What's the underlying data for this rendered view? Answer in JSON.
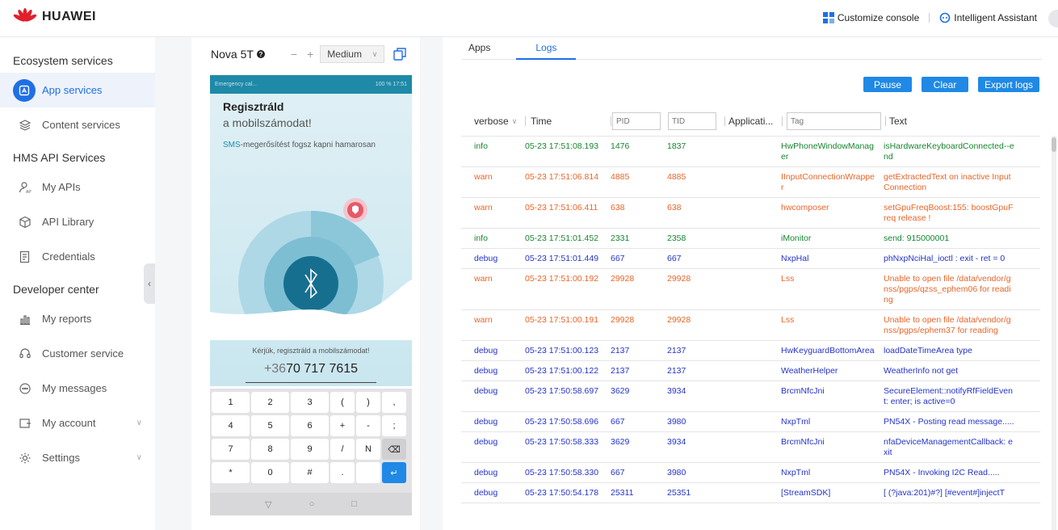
{
  "header": {
    "brand": "HUAWEI",
    "customize_console": "Customize console",
    "intelligent_assistant": "Intelligent Assistant"
  },
  "sidebar": {
    "sections": [
      {
        "title": "Ecosystem services"
      },
      {
        "title": "HMS API Services"
      },
      {
        "title": "Developer center"
      }
    ],
    "items": [
      {
        "label": "App services",
        "icon": "app-services-icon",
        "active": true
      },
      {
        "label": "Content services",
        "icon": "layers-icon"
      },
      {
        "label": "My APIs",
        "icon": "api-user-icon"
      },
      {
        "label": "API Library",
        "icon": "cube-icon"
      },
      {
        "label": "Credentials",
        "icon": "credentials-icon"
      },
      {
        "label": "My reports",
        "icon": "bar-chart-icon"
      },
      {
        "label": "Customer service",
        "icon": "headset-icon"
      },
      {
        "label": "My messages",
        "icon": "message-icon"
      },
      {
        "label": "My account",
        "icon": "account-icon"
      },
      {
        "label": "Settings",
        "icon": "gear-icon"
      }
    ]
  },
  "device": {
    "name": "Nova 5T",
    "size_selected": "Medium",
    "zoom_out": "−",
    "zoom_in": "+",
    "status_left": "Emergency cal...",
    "status_right": "100 %  17:51",
    "screen_title": "Regisztráld",
    "screen_subtitle": "a mobilszámodat!",
    "sms_highlight": "SMS",
    "sms_rest": "-megerősítést fogsz kapni hamarosan",
    "hint": "Kérjük, regisztráld a mobilszámodat!",
    "phone_prefix": "+36",
    "phone_number": "70 717 7615",
    "keys": [
      [
        "1",
        "2",
        "3",
        "(",
        ")",
        ","
      ],
      [
        "4",
        "5",
        "6",
        "+",
        "-",
        ";"
      ],
      [
        "7",
        "8",
        "9",
        "/",
        "N",
        "⌫"
      ],
      [
        "*",
        "0",
        "#",
        ".",
        "",
        "↵"
      ]
    ],
    "nav_back": "▽",
    "nav_home": "○",
    "nav_recent": "□"
  },
  "logs": {
    "tabs": [
      "Apps",
      "Logs"
    ],
    "active_tab": "Logs",
    "buttons": {
      "pause": "Pause",
      "clear": "Clear",
      "export": "Export logs"
    },
    "columns": {
      "level_filter": "verbose",
      "time": "Time",
      "pid_placeholder": "PID",
      "tid_placeholder": "TID",
      "application": "Applicati...",
      "tag_placeholder": "Tag",
      "text": "Text"
    },
    "rows": [
      {
        "level": "info",
        "time": "05-23 17:51:08.193",
        "pid": "1476",
        "tid": "1837",
        "tag": "HwPhoneWindowManager",
        "text": "isHardwareKeyboardConnected--end"
      },
      {
        "level": "warn",
        "time": "05-23 17:51:06.814",
        "pid": "4885",
        "tid": "4885",
        "tag": "IInputConnectionWrapper",
        "text": "getExtractedText on inactive InputConnection"
      },
      {
        "level": "warn",
        "time": "05-23 17:51:06.411",
        "pid": "638",
        "tid": "638",
        "tag": "hwcomposer",
        "text": "setGpuFreqBoost:155: boostGpuFreq release !"
      },
      {
        "level": "info",
        "time": "05-23 17:51:01.452",
        "pid": "2331",
        "tid": "2358",
        "tag": "iMonitor",
        "text": "send: 915000001"
      },
      {
        "level": "debug",
        "time": "05-23 17:51:01.449",
        "pid": "667",
        "tid": "667",
        "tag": "NxpHal",
        "text": "phNxpNciHal_ioctl : exit - ret = 0"
      },
      {
        "level": "warn",
        "time": "05-23 17:51:00.192",
        "pid": "29928",
        "tid": "29928",
        "tag": "Lss",
        "text": "Unable to open file /data/vendor/gnss/pgps/qzss_ephem06 for reading"
      },
      {
        "level": "warn",
        "time": "05-23 17:51:00.191",
        "pid": "29928",
        "tid": "29928",
        "tag": "Lss",
        "text": "Unable to open file /data/vendor/gnss/pgps/ephem37 for reading"
      },
      {
        "level": "debug",
        "time": "05-23 17:51:00.123",
        "pid": "2137",
        "tid": "2137",
        "tag": "HwKeyguardBottomArea",
        "text": "loadDateTimeArea type"
      },
      {
        "level": "debug",
        "time": "05-23 17:51:00.122",
        "pid": "2137",
        "tid": "2137",
        "tag": "WeatherHelper",
        "text": "WeatherInfo not get"
      },
      {
        "level": "debug",
        "time": "05-23 17:50:58.697",
        "pid": "3629",
        "tid": "3934",
        "tag": "BrcmNfcJni",
        "text": "SecureElement::notifyRfFieldEvent: enter; is active=0"
      },
      {
        "level": "debug",
        "time": "05-23 17:50:58.696",
        "pid": "667",
        "tid": "3980",
        "tag": "NxpTml",
        "text": "PN54X - Posting read message....."
      },
      {
        "level": "debug",
        "time": "05-23 17:50:58.333",
        "pid": "3629",
        "tid": "3934",
        "tag": "BrcmNfcJni",
        "text": "nfaDeviceManagementCallback: exit"
      },
      {
        "level": "debug",
        "time": "05-23 17:50:58.330",
        "pid": "667",
        "tid": "3980",
        "tag": "NxpTml",
        "text": "PN54X - Invoking I2C Read....."
      },
      {
        "level": "debug",
        "time": "05-23 17:50:54.178",
        "pid": "25311",
        "tid": "25351",
        "tag": "[StreamSDK]",
        "text": "[ (?java:201)#?] [#event#]injectT"
      }
    ]
  },
  "colors": {
    "accent": "#1f6fe5",
    "button": "#1f89e5",
    "info": "#17852f",
    "warn": "#e8652a",
    "debug": "#2533c9"
  }
}
